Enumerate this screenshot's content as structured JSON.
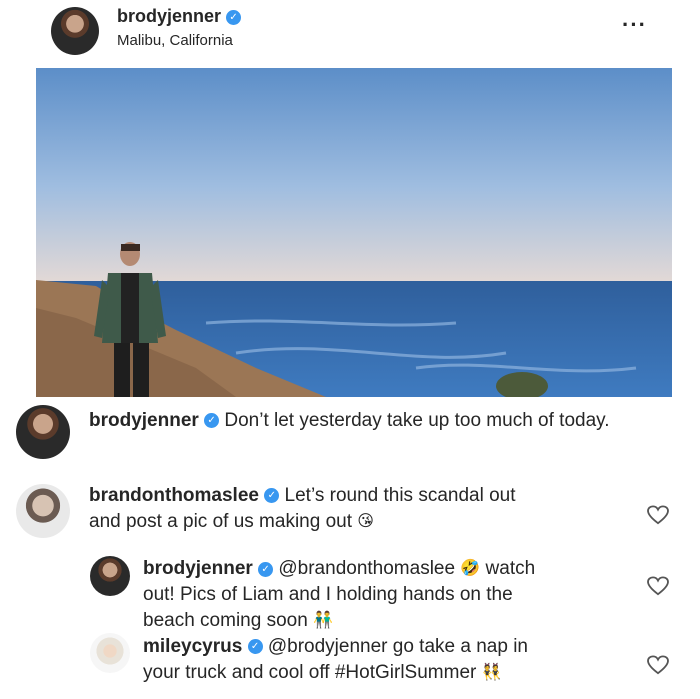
{
  "post": {
    "username": "brodyjenner",
    "location": "Malibu, California",
    "more_icon": "···"
  },
  "caption": {
    "username": "brodyjenner",
    "text": "Don’t let yesterday take up too much of today."
  },
  "comments": [
    {
      "username": "brandonthomaslee",
      "line1": "Let’s round this scandal out",
      "line2": "and post a pic of us making out",
      "emoji": "😘"
    },
    {
      "username": "brodyjenner",
      "mention": "@brandonthomaslee",
      "emoji1": "🤣",
      "line1_end": "watch",
      "line2": "out! Pics of Liam and I holding hands on the",
      "line3": "beach coming soon",
      "emoji2": "👬"
    },
    {
      "username": "mileycyrus",
      "line1": "@brodyjenner go take a nap in",
      "line2": "your truck and cool off #HotGirlSummer",
      "emoji": "👯"
    }
  ],
  "colors": {
    "verified": "#3897f0",
    "text": "#262626"
  }
}
